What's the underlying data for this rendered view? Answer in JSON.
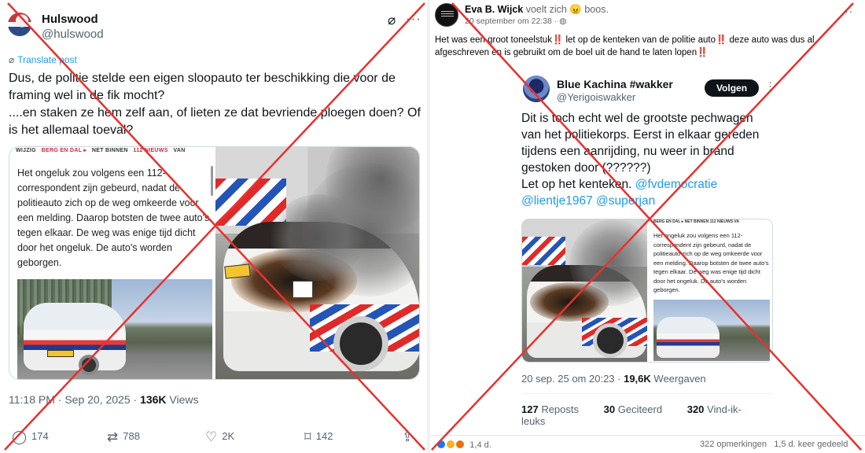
{
  "left_post": {
    "display_name": "Hulswood",
    "handle": "@hulswood",
    "translate": "Translate post",
    "text_lines": [
      "Dus, de politie stelde een eigen sloopauto ter beschikking die voor de",
      "framing wel in de fik mocht?",
      "....en staken ze hem zelf aan, of lieten ze dat bevriende ploegen doen? Of",
      "is het allemaal toeval?"
    ],
    "news_bar": {
      "a": "WIJZIG",
      "b": "BERG EN DAL ▸",
      "c": "NET BINNEN",
      "d": "112 NIEUWS",
      "e": "VAN"
    },
    "news_text": "Het ongeluk zou volgens een 112-correspondent zijn gebeurd, nadat de politieauto zich op de weg omkeerde voor een melding. Daarop botsten de twee auto's tegen elkaar. De weg was enige tijd dicht door het ongeluk. De auto's worden geborgen.",
    "meta_time": "11:18 PM · Sep 20, 2025 · ",
    "meta_views_count": "136K",
    "meta_views_label": " Views",
    "actions": {
      "replies": "174",
      "reposts": "788",
      "likes": "2K",
      "bookmarks": "142"
    }
  },
  "right_post": {
    "author": "Eva B. Wijck",
    "feeling_pre": " voelt zich ",
    "feeling_emoji": "😠",
    "feeling_post": " boos.",
    "date": "20 september om 22:38 · ",
    "text_part1": "Het was een groot toneelstuk",
    "text_part2": " let op de kenteken van de politie auto",
    "text_part3": " deze auto was dus al afgeschreven en is gebruikt om de boel uit de hand te laten lopen",
    "bang": "‼️",
    "embedded": {
      "display_name": "Blue Kachina #wakker",
      "handle": "@Yerigoiswakker",
      "follow_label": "Volgen",
      "text": "Dit is toch echt wel de grootste pechwagen van het politiekorps. Eerst in elkaar gereden tijdens een aanrijding, nu weer in brand gestoken door (??????)",
      "text2": "Let op het kenteken. ",
      "mention1": "@fvdemocratie",
      "mention2": "@lientje1967",
      "mention3": "@superjan",
      "news_text": "Het ongeluk zou volgens een 112-correspondent zijn gebeurd, nadat de politieauto zich op de weg omkeerde voor een melding. Daarop botsten de twee auto's tegen elkaar. De weg was enige tijd dicht door het ongeluk. De auto's worden geborgen.",
      "news_bar": "BERG EN DAL ▸  NET BINNEN  112 NIEUWS  VA",
      "meta_time": "20 sep. 25 om 20:23 · ",
      "meta_views_count": "19,6K",
      "meta_views_label": " Weergaven",
      "stats": {
        "reposts_count": "127",
        "reposts_label": " Reposts",
        "quotes_count": "30",
        "quotes_label": " Geciteerd",
        "likes_count": "320",
        "likes_label": " Vind-ik-leuks"
      }
    },
    "footer": {
      "reaction_count": "1,4 d.",
      "comments": "322 opmerkingen",
      "shares": "1,5 d. keer gedeeld"
    }
  },
  "colors": {
    "cross_red": "#e8312f",
    "x_blue": "#1d9bf0",
    "alert_red": "#e0245e"
  }
}
